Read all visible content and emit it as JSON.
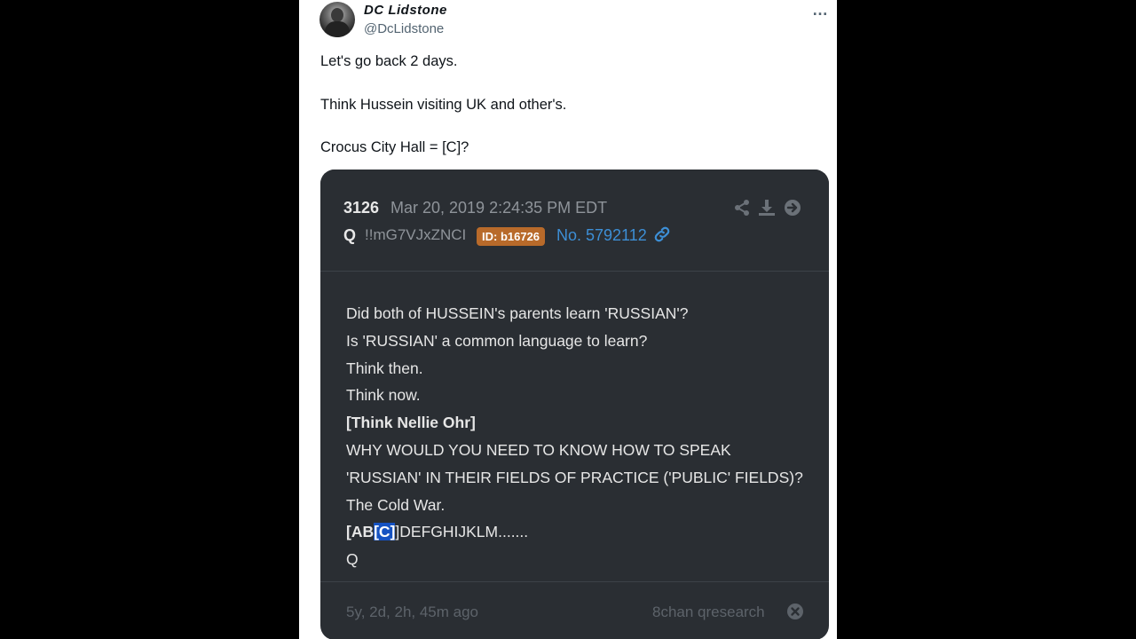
{
  "tweet": {
    "display_name": "DC Lidstone",
    "handle": "@DcLidstone",
    "more_icon": "more-horizontal-icon",
    "lines": [
      "Let's go back 2 days.",
      "Think Hussein visiting UK and other's.",
      "Crocus City Hall = [C]?"
    ]
  },
  "qpost": {
    "number": "3126",
    "date": "Mar 20, 2019 2:24:35 PM EDT",
    "author": "Q",
    "tripcode": "!!mG7VJxZNCI",
    "id_badge": "ID: b16726",
    "post_no": "No. 5792112",
    "icons": [
      "share-icon",
      "download-icon",
      "arrow-right-circle-icon",
      "link-icon",
      "close-circle-icon"
    ],
    "body": {
      "line1": "Did both of HUSSEIN's parents learn 'RUSSIAN'?",
      "line2": "Is 'RUSSIAN' a common language to learn?",
      "line3": "Think then.",
      "line4": "Think now.",
      "line5": "[Think Nellie Ohr]",
      "line6": "WHY WOULD YOU NEED TO KNOW HOW TO SPEAK",
      "line7": "'RUSSIAN' IN THEIR FIELDS OF PRACTICE ('PUBLIC' FIELDS)?",
      "line8": "The Cold War.",
      "line9_a": "[AB",
      "line9_b": "[C]",
      "line9_c": "]DEFGHIJKLM.......",
      "line10": "Q"
    },
    "footer_time": "5y, 2d, 2h, 45m ago",
    "footer_source": "8chan qresearch"
  },
  "colors": {
    "card_bg": "#2a2e33",
    "badge": "#b86a2a",
    "link": "#3d8fd6",
    "highlight": "#1552c2"
  }
}
